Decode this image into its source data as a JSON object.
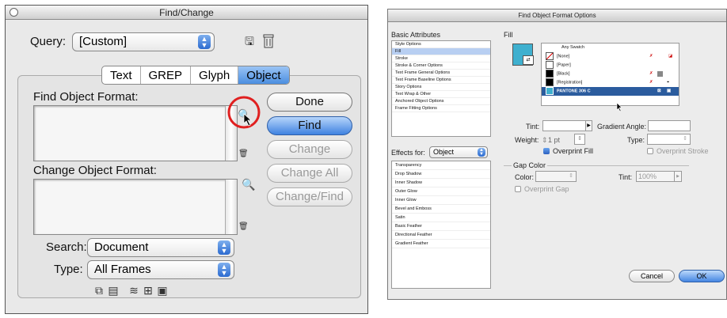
{
  "find_change": {
    "title": "Find/Change",
    "query_label": "Query:",
    "query_value": "[Custom]",
    "tabs": [
      "Text",
      "GREP",
      "Glyph",
      "Object"
    ],
    "selected_tab": "Object",
    "find_label": "Find Object Format:",
    "change_label": "Change Object Format:",
    "buttons": {
      "done": "Done",
      "find": "Find",
      "change": "Change",
      "change_all": "Change All",
      "change_find": "Change/Find"
    },
    "search_label": "Search:",
    "search_value": "Document",
    "type_label": "Type:",
    "type_value": "All Frames"
  },
  "format_options": {
    "title": "Find Object Format Options",
    "basic_header": "Basic Attributes",
    "basic_items": [
      "Style Options",
      "Fill",
      "Stroke",
      "Stroke & Corner Options",
      "Text Frame General Options",
      "Text Frame Baseline Options",
      "Story Options",
      "Text Wrap & Other",
      "Anchored Object Options",
      "Frame Fitting Options"
    ],
    "selected_basic": "Fill",
    "effects_label": "Effects for:",
    "effects_value": "Object",
    "effects_items": [
      "Transparency",
      "Drop Shadow",
      "Inner Shadow",
      "Outer Glow",
      "Inner Glow",
      "Bevel and Emboss",
      "Satin",
      "Basic Feather",
      "Directional Feather",
      "Gradient Feather"
    ],
    "fill_header": "Fill",
    "swatches": [
      "Any Swatch",
      "[None]",
      "[Paper]",
      "[Black]",
      "[Registration]",
      "PANTONE 306 C"
    ],
    "selected_swatch": "PANTONE 306 C",
    "tint_label": "Tint:",
    "gradient_angle_label": "Gradient Angle:",
    "weight_label": "Weight:",
    "weight_value": "1 pt",
    "type_label": "Type:",
    "overprint_fill": "Overprint Fill",
    "overprint_stroke": "Overprint Stroke",
    "gap_color_header": "Gap Color",
    "color_label": "Color:",
    "gap_tint_label": "Tint:",
    "gap_tint_value": "100%",
    "overprint_gap": "Overprint Gap",
    "cancel": "Cancel",
    "ok": "OK",
    "colors": {
      "pantone": "#3fb0cf",
      "selection": "#2b5c9e"
    }
  }
}
